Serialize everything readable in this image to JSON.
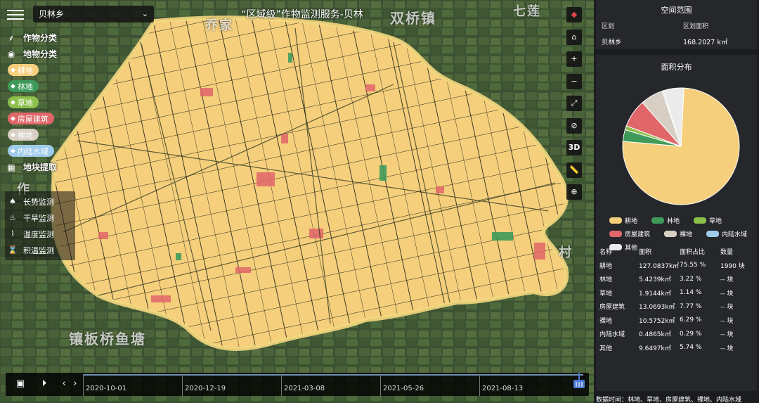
{
  "header": {
    "region_select": "贝林乡",
    "title": "“区域级”作物监测服务-贝林"
  },
  "map_labels": [
    "双桥镇",
    "七莲",
    "乔家",
    "镶板桥鱼塘",
    "作",
    "村"
  ],
  "layers": {
    "crop_heading": "作物分类",
    "land_heading": "地物分类",
    "items": [
      {
        "label": "耕地",
        "color": "#f5cf7b",
        "icon": "wheat-icon"
      },
      {
        "label": "林地",
        "color": "#3f9a5a",
        "icon": "tree-icon"
      },
      {
        "label": "草地",
        "color": "#8cc04b",
        "icon": "grass-icon"
      },
      {
        "label": "房屋建筑",
        "color": "#e0666a",
        "icon": "building-icon"
      },
      {
        "label": "裸地",
        "color": "#d8cfc4",
        "icon": "bare-land-icon"
      },
      {
        "label": "内陆水域",
        "color": "#9fcbea",
        "icon": "water-icon"
      }
    ],
    "plot_heading": "地块提取"
  },
  "monitoring": [
    {
      "label": "长势监测",
      "icon": "sprout-icon"
    },
    {
      "label": "干旱监测",
      "icon": "drought-icon"
    },
    {
      "label": "温度监测",
      "icon": "thermometer-icon"
    },
    {
      "label": "积温监测",
      "icon": "accumulated-temp-icon"
    }
  ],
  "controls": [
    "compass-icon",
    "home-icon",
    "zoom-in-icon",
    "zoom-out-icon",
    "fullscreen-icon",
    "hide-icon",
    "3D",
    "ruler-icon",
    "locate-icon"
  ],
  "controls_3d_label": "3D",
  "timeline": {
    "dates": [
      "2020-10-01",
      "2020-12-19",
      "2021-03-08",
      "2021-05-26",
      "2021-08-13"
    ]
  },
  "spatial": {
    "title": "空间范围",
    "col_region": "区划",
    "col_area": "区划面积",
    "region": "贝林乡",
    "area": "168.2027 k㎡"
  },
  "distribution": {
    "title": "面积分布",
    "headers": [
      "名称",
      "面积",
      "面积占比",
      "数量"
    ],
    "rows": [
      {
        "name": "耕地",
        "area": "127.0837k㎡",
        "pct": "75.55 %",
        "count": "1990 块"
      },
      {
        "name": "林地",
        "area": "5.4239k㎡",
        "pct": "3.22 %",
        "count": "-- 块"
      },
      {
        "name": "草地",
        "area": "1.9144k㎡",
        "pct": "1.14 %",
        "count": "-- 块"
      },
      {
        "name": "房屋建筑",
        "area": "13.0693k㎡",
        "pct": "7.77 %",
        "count": "-- 块"
      },
      {
        "name": "裸地",
        "area": "10.5752k㎡",
        "pct": "6.29 %",
        "count": "-- 块"
      },
      {
        "name": "内陆水域",
        "area": "0.4865k㎡",
        "pct": "0.29 %",
        "count": "-- 块"
      },
      {
        "name": "其他",
        "area": "9.6497k㎡",
        "pct": "5.74 %",
        "count": "-- 块"
      }
    ]
  },
  "chart_data": {
    "type": "pie",
    "categories": [
      "耕地",
      "林地",
      "草地",
      "房屋建筑",
      "裸地",
      "内陆水域",
      "其他"
    ],
    "values": [
      75.55,
      3.22,
      1.14,
      7.77,
      6.29,
      0.29,
      5.74
    ],
    "colors": [
      "#f5cf7b",
      "#3f9a5a",
      "#8cc04b",
      "#e0666a",
      "#d8cfc4",
      "#9fcbea",
      "#ebebeb"
    ],
    "legend": "bottom"
  },
  "footer_note": "数据时间：林地、草地、房屋建筑、裸地、内陆水域"
}
